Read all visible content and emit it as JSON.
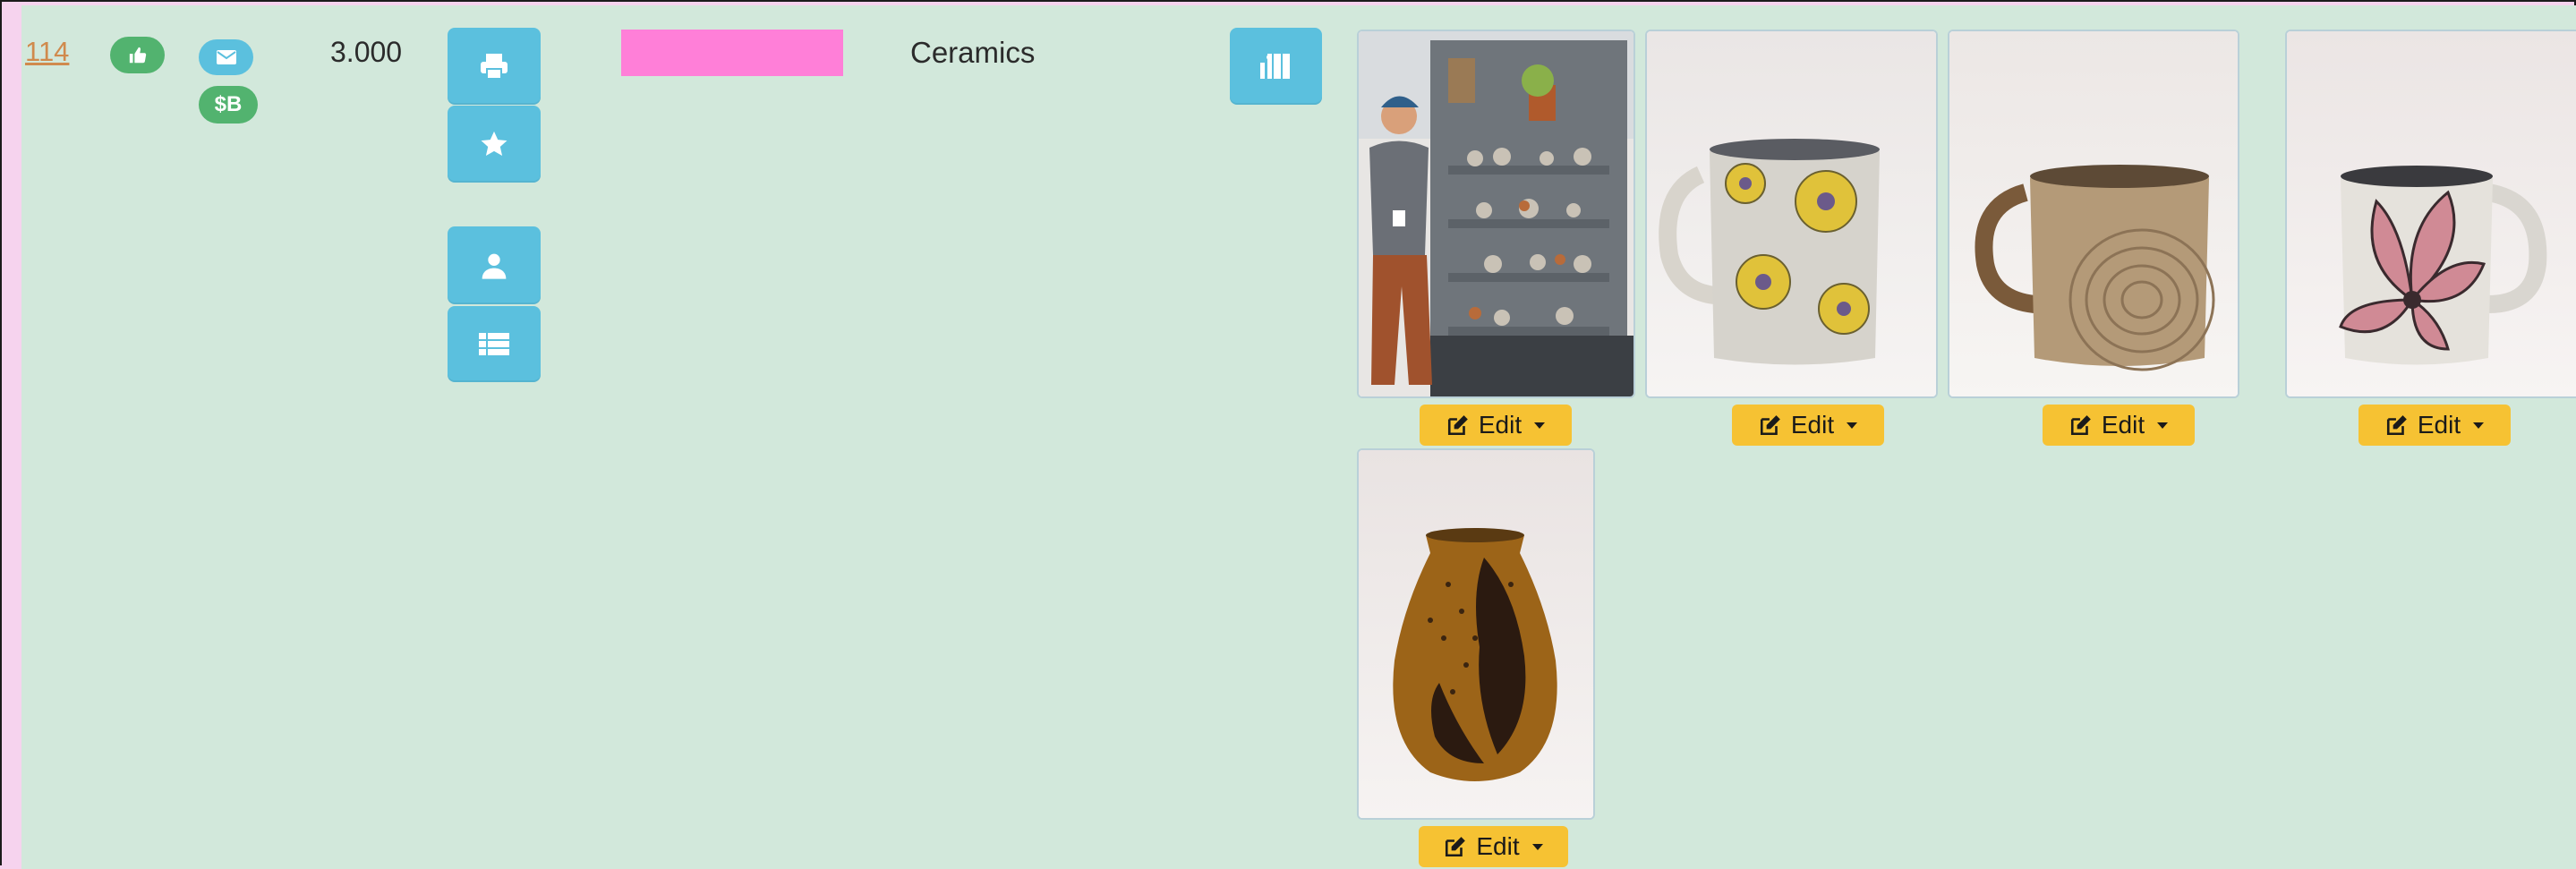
{
  "row": {
    "id_link": "114",
    "score": "3.000",
    "category": "Ceramics",
    "money_badge": "$B",
    "swatch_color": "#ff7fd8"
  },
  "icons": {
    "approve": "thumbs-up-icon",
    "email": "envelope-icon",
    "print": "print-icon",
    "star": "star-icon",
    "user": "user-icon",
    "list": "list-icon",
    "booth": "booth-icon",
    "edit": "edit-icon"
  },
  "images": [
    {
      "edit_label": "Edit",
      "subject": "artist-booth-photo"
    },
    {
      "edit_label": "Edit",
      "subject": "sunflower-mug"
    },
    {
      "edit_label": "Edit",
      "subject": "carved-spiral-mug"
    },
    {
      "edit_label": "Edit",
      "subject": "pink-flower-mug"
    },
    {
      "edit_label": "Edit",
      "subject": "amber-vase"
    }
  ],
  "colors": {
    "row_bg": "#d2e8db",
    "page_bg": "#f6d3ee",
    "button_blue": "#5bc0de",
    "badge_green": "#52b36f",
    "edit_yellow": "#f6c233",
    "link_orange": "#d08a4d"
  }
}
